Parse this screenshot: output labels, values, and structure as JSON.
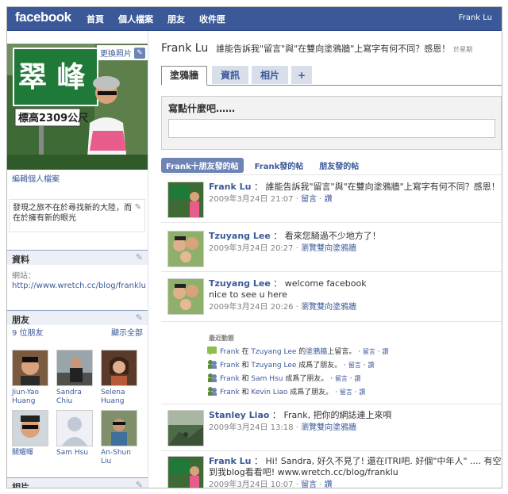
{
  "topbar": {
    "logo": "facebook",
    "nav": [
      "首頁",
      "個人檔案",
      "朋友",
      "收件匣"
    ],
    "user": "Frank Lu"
  },
  "left": {
    "change_photo": "更換照片",
    "edit_profile": "編輯個人檔案",
    "status": "發現之旅不在於尋找新的大陸，而在於擁有新的眼光",
    "info": {
      "title": "資料",
      "label": "網站：",
      "link": "http://www.wretch.cc/blog/franklu"
    },
    "friends": {
      "title": "朋友",
      "count": "9 位朋友",
      "show_all": "顯示全部",
      "list": [
        {
          "name": "Jiun-Yao Huang"
        },
        {
          "name": "Sandra Chiu"
        },
        {
          "name": "Selena Huang"
        },
        {
          "name": "關耀暉"
        },
        {
          "name": "Sam Hsu"
        },
        {
          "name": "An-Shun Liu"
        }
      ]
    },
    "photos_title": "相片"
  },
  "main": {
    "name": "Frank Lu",
    "status": "誰能告訴我\"留言\"與\"在雙向塗鴉牆\"上寫字有何不同？感恩！",
    "status_time": "於星期",
    "tabs": [
      "塗鴉牆",
      "資訊",
      "相片",
      "+"
    ],
    "composer_prompt": "寫點什麼吧……",
    "filters": [
      "Frank十朋友發的帖",
      "Frank發的帖",
      "朋友發的帖"
    ],
    "posts": [
      {
        "author": "Frank Lu",
        "text": "誰能告訴我\"留言\"與\"在雙向塗鴉牆\"上寫字有何不同？感恩！",
        "time": "2009年3月24日 21:07",
        "links": [
          "留言",
          "讚"
        ]
      },
      {
        "author": "Tzuyang Lee",
        "text": "看來您騎過不少地方了！",
        "time": "2009年3月24日 20:27",
        "links": [
          "瀏覽雙向塗鴉牆"
        ]
      },
      {
        "author": "Tzuyang Lee",
        "text": "welcome facebook",
        "text2": "nice to see u here",
        "time": "2009年3月24日 20:26",
        "links": [
          "瀏覽雙向塗鴉牆"
        ]
      },
      {
        "author": "Stanley Liao",
        "text": "Frank, 把你的網誌連上來唄",
        "time": "2009年3月24日 13:18",
        "links": [
          "瀏覽雙向塗鴉牆"
        ]
      },
      {
        "author": "Frank Lu",
        "text": "Hi! Sandra, 好久不見了! 還在ITRI吧. 好個\"中年人\" .... 有空到我blog看看吧! www.wretch.cc/blog/franklu",
        "time": "2009年3月24日 10:07",
        "links": [
          "留言",
          "讚"
        ]
      }
    ],
    "recent": {
      "title": "最近動態",
      "items": [
        {
          "who": "Frank",
          "mid": "在",
          "target": "Tzuyang Lee",
          "after": "的",
          "link": "塗鴉牆",
          "end": "上留言。",
          "actions": [
            "留言",
            "讚"
          ]
        },
        {
          "who": "Frank",
          "mid": "和",
          "target": "Tzuyang Lee",
          "after": "成爲了朋友。",
          "link": "",
          "end": "",
          "actions": [
            "留言",
            "讚"
          ]
        },
        {
          "who": "Frank",
          "mid": "和",
          "target": "Sam Hsu",
          "after": "成爲了朋友。",
          "link": "",
          "end": "",
          "actions": [
            "留言",
            "讚"
          ]
        },
        {
          "who": "Frank",
          "mid": "和",
          "target": "Kevin Liao",
          "after": "成爲了朋友。",
          "link": "",
          "end": "",
          "actions": [
            "留言",
            "讚"
          ]
        }
      ]
    }
  },
  "colors": {
    "brand": "#3b5998",
    "link": "#3b5998",
    "muted": "#808080"
  }
}
